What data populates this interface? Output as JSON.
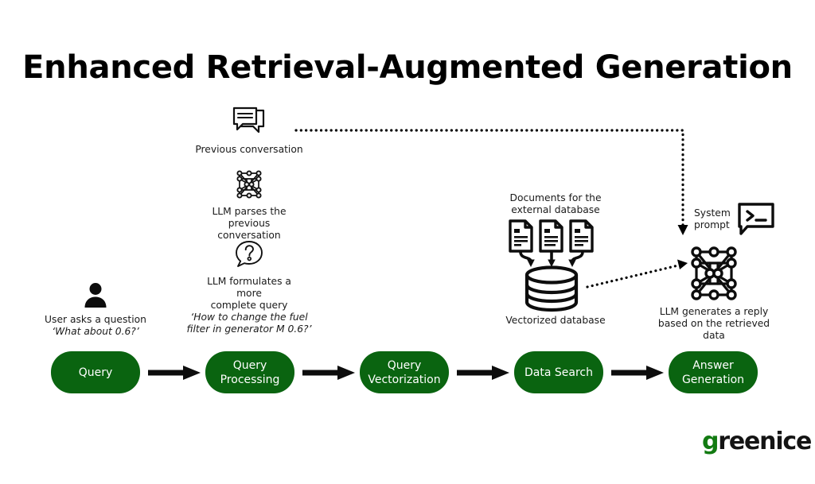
{
  "page": {
    "title": "Enhanced Retrieval-Augmented Generation",
    "background": "#ffffff"
  },
  "colors": {
    "pill_green": "#0a6410",
    "logo_green": "#137b12",
    "ink": "#000000",
    "caption": "#1a1a1a"
  },
  "top_flow": {
    "previous_conversation": {
      "icon": "chat-bubbles-icon",
      "label": "Previous conversation"
    },
    "llm_parse": {
      "icon": "neural-network-icon",
      "label_line1": "LLM parses the previous",
      "label_line2": "conversation"
    },
    "llm_formulate": {
      "icon": "question-bubble-icon",
      "label_line1": "LLM formulates a more",
      "label_line2": "complete query"
    },
    "user": {
      "icon": "user-icon",
      "label": "User asks a question",
      "quote": "‘What about 0.6?’"
    },
    "reformulated_query": {
      "quote_line1": "‘How to change the fuel",
      "quote_line2": "filter in generator M 0.6?’"
    },
    "documents": {
      "icon": "document-icon",
      "label_line1": "Documents for the",
      "label_line2": "external database",
      "count": 3
    },
    "database": {
      "icon": "database-cylinder-icon",
      "label": "Vectorized database"
    },
    "system_prompt": {
      "icon": "terminal-bubble-icon",
      "label_line1": "System",
      "label_line2": "prompt"
    },
    "llm_generate": {
      "icon": "neural-network-icon",
      "label_line1": "LLM generates a reply",
      "label_line2": "based on the retrieved",
      "label_line3": "data"
    }
  },
  "pipeline": {
    "steps": [
      {
        "id": "query",
        "line1": "Query",
        "line2": ""
      },
      {
        "id": "query-processing",
        "line1": "Query",
        "line2": "Processing"
      },
      {
        "id": "query-vectorization",
        "line1": "Query",
        "line2": "Vectorization"
      },
      {
        "id": "data-search",
        "line1": "Data Search",
        "line2": ""
      },
      {
        "id": "answer-generation",
        "line1": "Answer",
        "line2": "Generation"
      }
    ]
  },
  "logo": {
    "first_letter": "g",
    "remaining": "reenice"
  }
}
